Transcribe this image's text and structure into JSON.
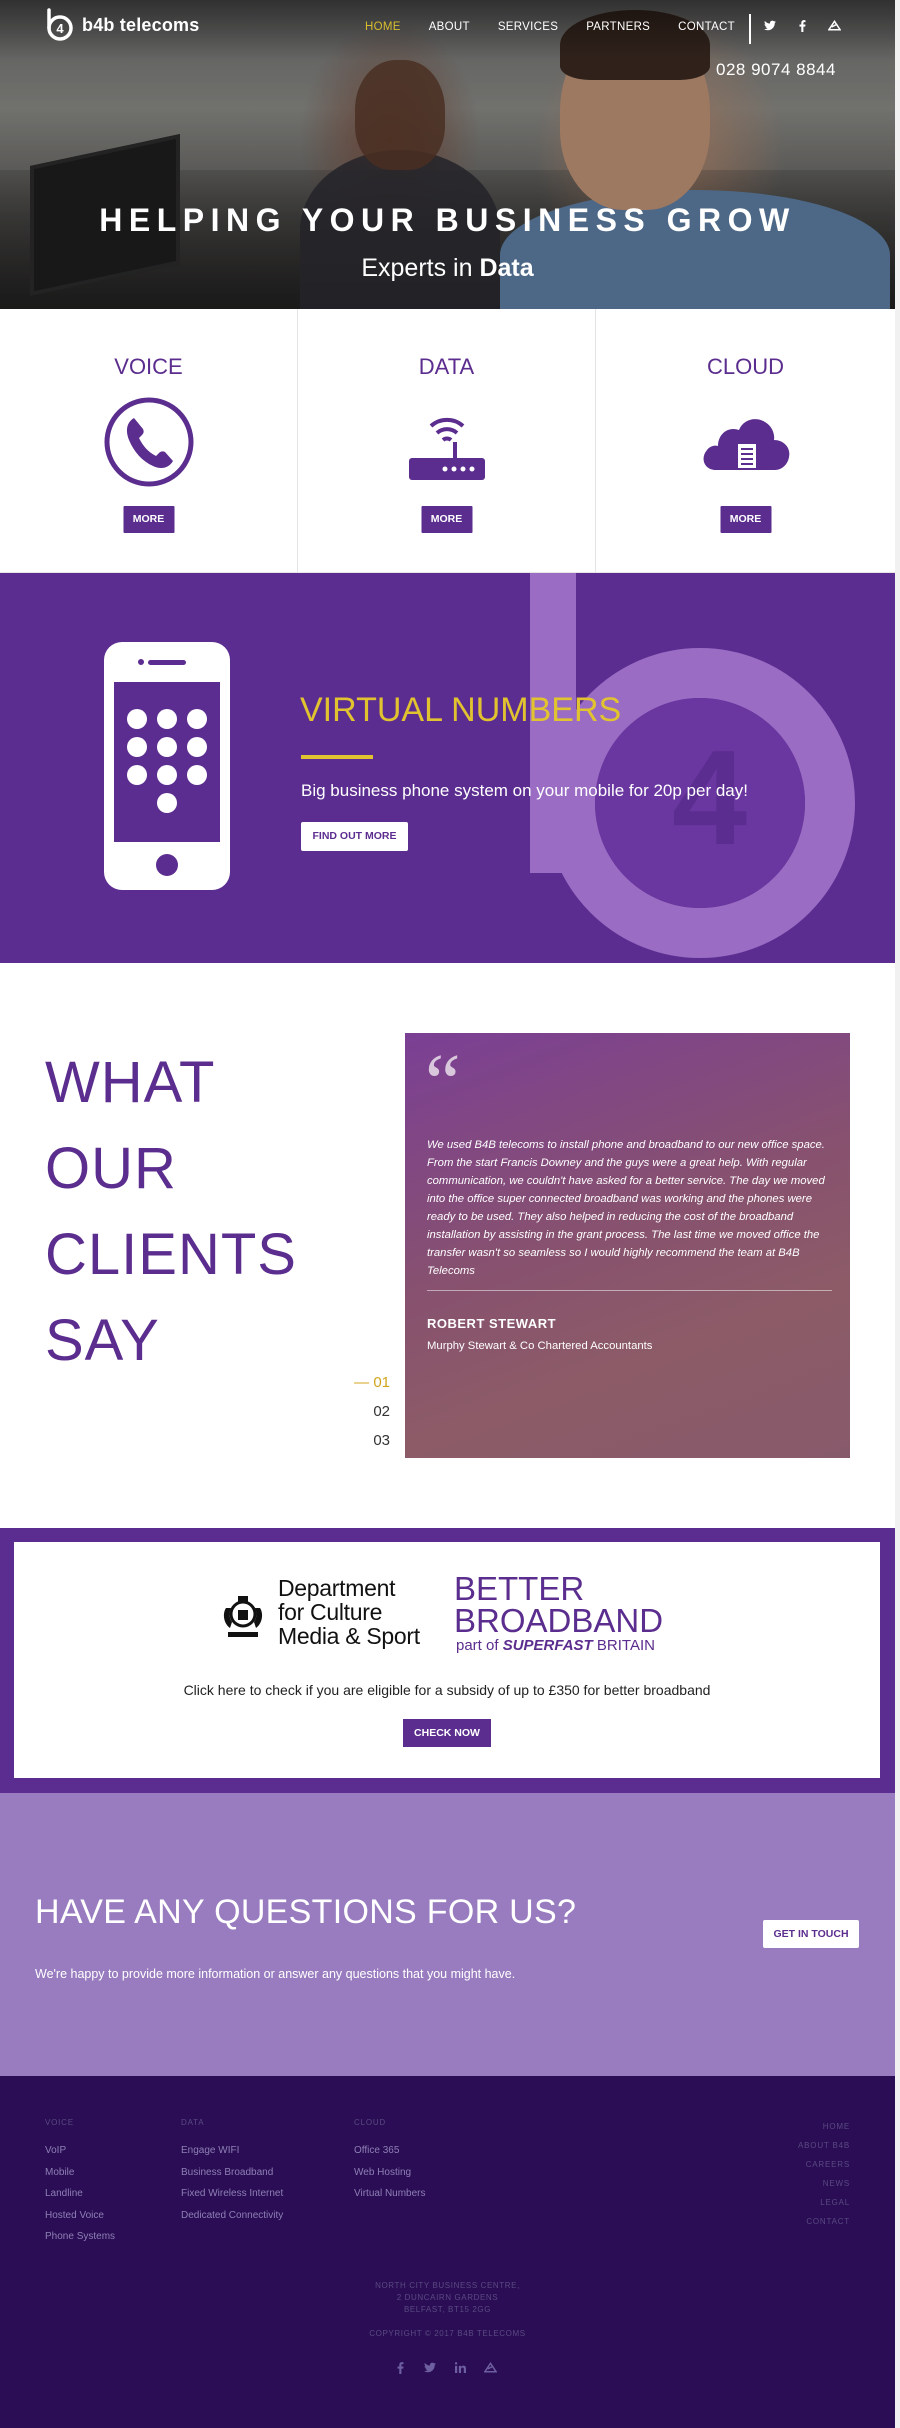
{
  "header": {
    "logo_text": "b4b telecoms",
    "nav": [
      "HOME",
      "ABOUT",
      "SERVICES",
      "PARTNERS",
      "CONTACT"
    ],
    "active_nav": "HOME",
    "social_icons": [
      "twitter-icon",
      "facebook-icon",
      "b4b-icon"
    ],
    "phone": "028 9074 8844"
  },
  "hero": {
    "title": "HELPING YOUR BUSINESS GROW",
    "subtitle_prefix": "Experts in",
    "subtitle_highlight": "Data"
  },
  "services": [
    {
      "title": "VOICE",
      "icon": "phone-icon",
      "button": "MORE"
    },
    {
      "title": "DATA",
      "icon": "router-icon",
      "button": "MORE"
    },
    {
      "title": "CLOUD",
      "icon": "cloud-icon",
      "button": "MORE"
    }
  ],
  "virtual_numbers": {
    "title": "VIRTUAL NUMBERS",
    "text": "Big business phone system on your mobile for 20p per day!",
    "button": "FIND OUT MORE",
    "watermark": "4"
  },
  "testimonials": {
    "heading": [
      "WHAT",
      "OUR",
      "CLIENTS",
      "SAY"
    ],
    "quote": "We used B4B telecoms to install phone and broadband to our new office space. From the start Francis Downey and the guys were a great help. With regular communication, we couldn't have asked for a better service. The day we moved into the office super connected broadband was working and the phones were ready to be used. They also helped in reducing the cost of the broadband installation by assisting in the grant process. The last time we moved office the transfer wasn't so seamless so I would highly recommend the team at B4B Telecoms",
    "name": "ROBERT STEWART",
    "company": "Murphy Stewart & Co Chartered Accountants",
    "slides": [
      "01",
      "02",
      "03"
    ],
    "active_slide": "01"
  },
  "broadband": {
    "dept_line1": "Department",
    "dept_line2": "for Culture",
    "dept_line3": "Media & Sport",
    "bb_line1": "BETTER",
    "bb_line2": "BROADBAND",
    "bb_line3_prefix": "part of",
    "bb_line3_highlight": "SUPERFAST",
    "bb_line3_suffix": "BRITAIN",
    "text": "Click here to check if you are eligible for a subsidy of up to £350 for better broadband",
    "button": "CHECK NOW"
  },
  "questions": {
    "title": "HAVE ANY QUESTIONS FOR US?",
    "text": "We're happy to provide more information or answer any questions that you might have.",
    "button": "GET IN TOUCH"
  },
  "footer": {
    "columns": [
      {
        "heading": "VOICE",
        "links": [
          "VoIP",
          "Mobile",
          "Landline",
          "Hosted Voice",
          "Phone Systems"
        ]
      },
      {
        "heading": "DATA",
        "links": [
          "Engage WIFI",
          "Business Broadband",
          "Fixed Wireless Internet",
          "Dedicated Connectivity"
        ]
      },
      {
        "heading": "CLOUD",
        "links": [
          "Office 365",
          "Web Hosting",
          "Virtual Numbers"
        ]
      }
    ],
    "right_links": [
      "HOME",
      "ABOUT B4B",
      "CAREERS",
      "NEWS",
      "LEGAL",
      "CONTACT"
    ],
    "address": [
      "NORTH CITY BUSINESS CENTRE,",
      "2 DUNCAIRN GARDENS",
      "BELFAST, BT15 2GG"
    ],
    "copyright": "COPYRIGHT © 2017 B4B TELECOMS",
    "social_icons": [
      "facebook-icon",
      "twitter-icon",
      "linkedin-icon",
      "b4b-icon"
    ]
  },
  "colors": {
    "brand_purple": "#5c2d90",
    "accent_yellow": "#e1c330",
    "lavender": "#987cbf",
    "footer": "#2a0d55"
  }
}
